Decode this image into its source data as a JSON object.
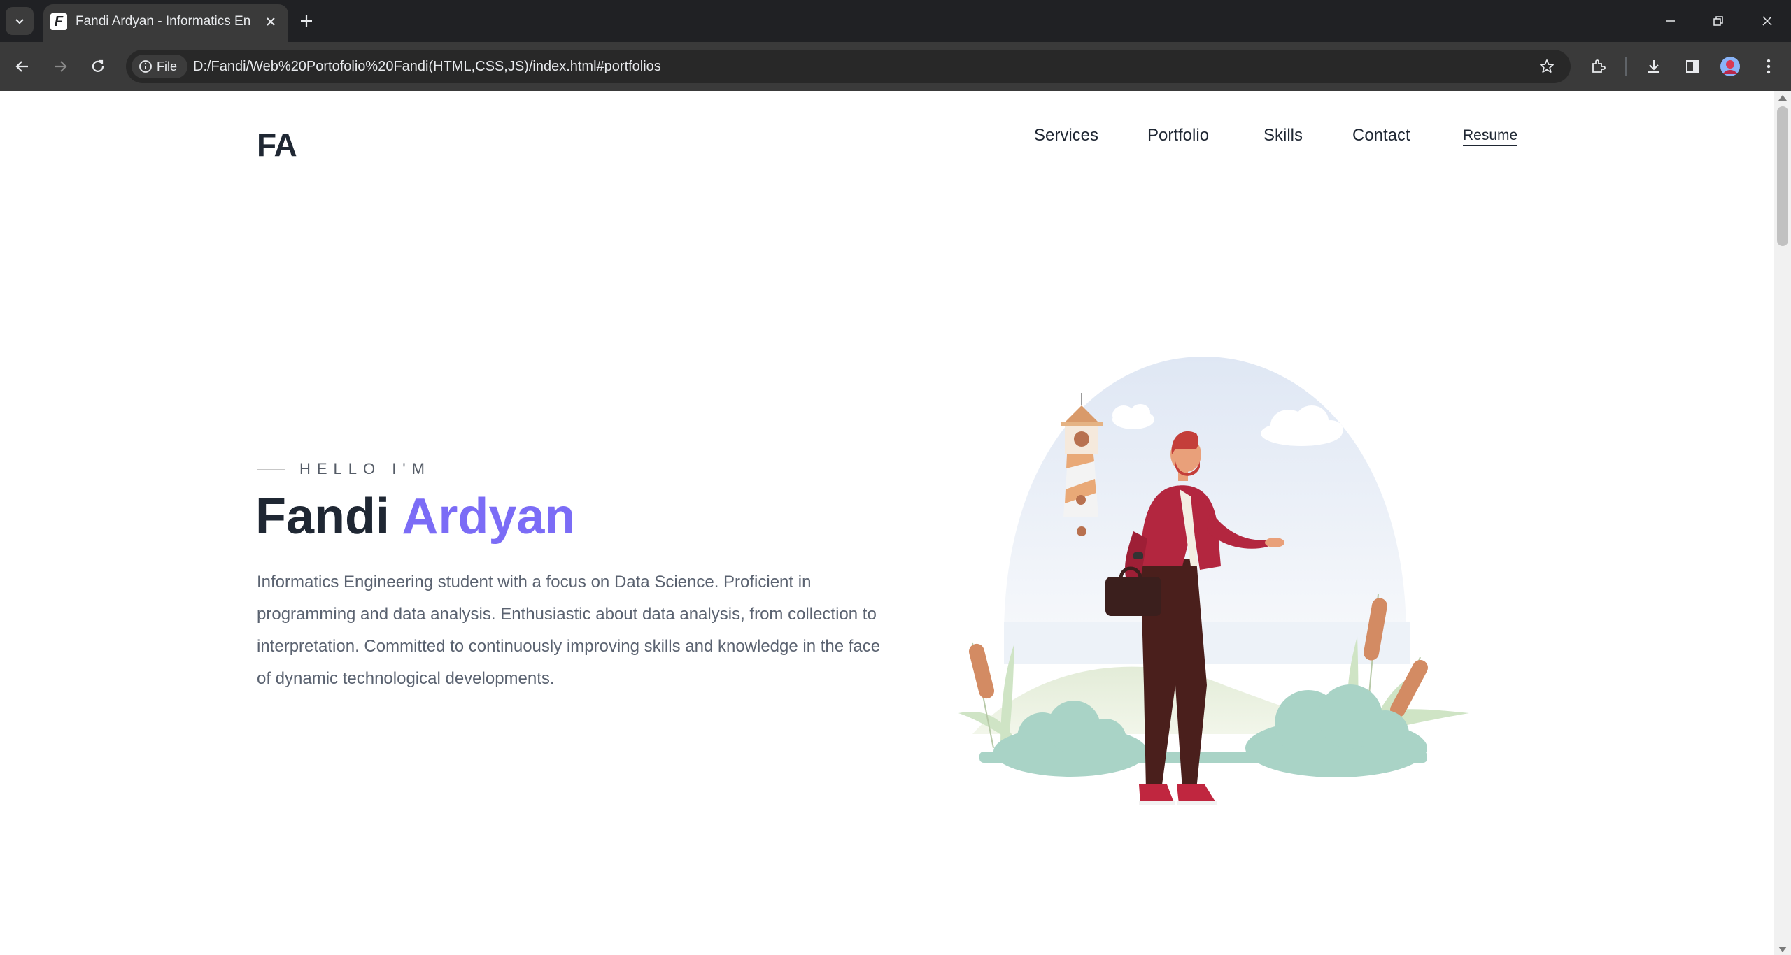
{
  "browser": {
    "tab_title": "Fandi Ardyan - Informatics Engi",
    "favicon_letter": "F",
    "security_chip": "File",
    "url": "D:/Fandi/Web%20Portofolio%20Fandi(HTML,CSS,JS)/index.html#portfolios",
    "icons": [
      "tab-search-icon",
      "close-icon",
      "new-tab-icon",
      "minimize-icon",
      "restore-icon",
      "window-close-icon",
      "back-icon",
      "forward-icon",
      "reload-icon",
      "info-icon",
      "bookmark-star-icon",
      "extensions-icon",
      "download-icon",
      "side-panel-icon",
      "profile-avatar",
      "more-menu-icon"
    ]
  },
  "page": {
    "logo": "FA",
    "nav": {
      "services": "Services",
      "portfolio": "Portfolio",
      "skills": "Skills",
      "contact": "Contact",
      "resume": "Resume"
    },
    "hero": {
      "greeting": "HELLO I'M",
      "first_name": "Fandi",
      "last_name": "Ardyan",
      "bio": "Informatics Engineering student with a focus on Data Science. Proficient in programming and data analysis. Enthusiastic about data analysis, from collection to interpretation. Committed to continuously improving skills and knowledge in the face of dynamic technological developments."
    }
  },
  "colors": {
    "accent": "#7b6cf6",
    "heading": "#1f2733",
    "body_text": "#5a6270",
    "chrome_dark": "#202124",
    "chrome_toolbar": "#3a3a3a"
  }
}
